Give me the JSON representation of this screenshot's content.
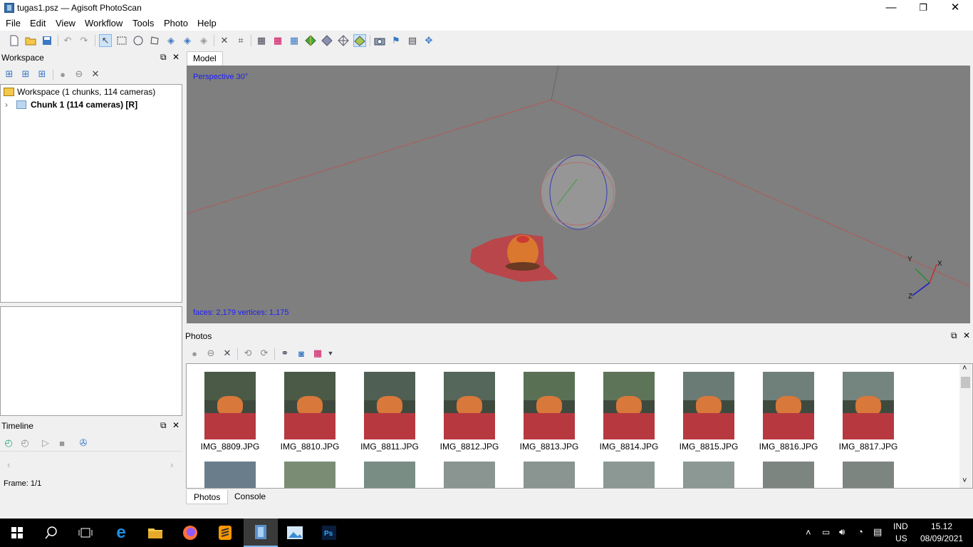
{
  "window": {
    "title": "tugas1.psz — Agisoft PhotoScan",
    "minimize": "—",
    "restore": "❐",
    "close": "✕"
  },
  "menu": [
    "File",
    "Edit",
    "View",
    "Workflow",
    "Tools",
    "Photo",
    "Help"
  ],
  "workspace": {
    "header": "Workspace",
    "root": "Workspace (1 chunks, 114 cameras)",
    "chunk": "Chunk 1 (114 cameras) [R]"
  },
  "timeline": {
    "header": "Timeline",
    "frame": "Frame: 1/1"
  },
  "model": {
    "tab": "Model",
    "projection": "Perspective 30°",
    "stats": "faces: 2,179 vertices: 1,175",
    "axis_x": "X",
    "axis_y": "Y",
    "axis_z": "Z"
  },
  "photos": {
    "header": "Photos",
    "row1": [
      "IMG_8809.JPG",
      "IMG_8810.JPG",
      "IMG_8811.JPG",
      "IMG_8812.JPG",
      "IMG_8813.JPG",
      "IMG_8814.JPG",
      "IMG_8815.JPG",
      "IMG_8816.JPG",
      "IMG_8817.JPG"
    ]
  },
  "bottom_tabs": [
    "Photos",
    "Console"
  ],
  "taskbar": {
    "lang_top": "IND",
    "lang_bottom": "US",
    "time": "15.12",
    "date": "08/09/2021"
  }
}
